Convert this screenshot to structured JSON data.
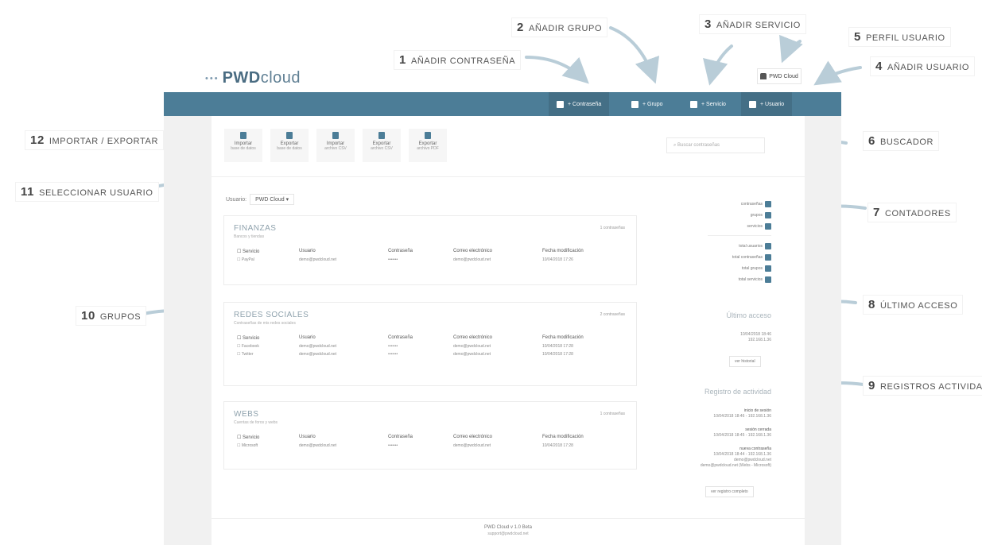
{
  "callouts": [
    {
      "num": "1",
      "label": "AÑADIR CONTRASEÑA"
    },
    {
      "num": "2",
      "label": "AÑADIR GRUPO"
    },
    {
      "num": "3",
      "label": "AÑADIR SERVICIO"
    },
    {
      "num": "4",
      "label": "AÑADIR USUARIO"
    },
    {
      "num": "5",
      "label": "PERFIL USUARIO"
    },
    {
      "num": "6",
      "label": "BUSCADOR"
    },
    {
      "num": "7",
      "label": "CONTADORES"
    },
    {
      "num": "8",
      "label": "ÚLTIMO ACCESO"
    },
    {
      "num": "9",
      "label": "REGISTROS ACTIVIDAD"
    },
    {
      "num": "10",
      "label": "GRUPOS"
    },
    {
      "num": "11",
      "label": "SELECCIONAR USUARIO"
    },
    {
      "num": "12",
      "label": "IMPORTAR / EXPORTAR"
    }
  ],
  "app": {
    "logo_dots": "•••",
    "logo_bold": "PWD",
    "logo_light": "cloud",
    "user_name": "PWD Cloud"
  },
  "topbar": {
    "password_btn": "+ Contraseña",
    "group_btn": "+ Grupo",
    "service_btn": "+ Servicio",
    "user_btn": "+ Usuario"
  },
  "import_export": [
    {
      "label": "Importar",
      "sub": "base de datos"
    },
    {
      "label": "Exportar",
      "sub": "base de datos"
    },
    {
      "label": "Importar",
      "sub": "archivo CSV"
    },
    {
      "label": "Exportar",
      "sub": "archivo CSV"
    },
    {
      "label": "Exportar",
      "sub": "archivo PDF"
    }
  ],
  "search": {
    "placeholder": "Buscar contraseñas"
  },
  "user_select": {
    "label": "Usuario:",
    "value": "PWD Cloud ▾"
  },
  "table_headers": [
    "☐ Servicio",
    "Usuario",
    "Contraseña",
    "Correo electrónico",
    "Fecha modificación"
  ],
  "groups": [
    {
      "name": "FINANZAS",
      "desc": "Bancos y tiendas",
      "count": "1 contraseñas",
      "rows": [
        [
          "☐ PayPal",
          "demo@pwdcloud.net",
          "•••••••",
          "demo@pwdcloud.net",
          "10/04/2018 17:26"
        ]
      ]
    },
    {
      "name": "REDES SOCIALES",
      "desc": "Contraseñas de mis redes sociales",
      "count": "2 contraseñas",
      "rows": [
        [
          "☐ Facebook",
          "demo@pwdcloud.net",
          "•••••••",
          "demo@pwdcloud.net",
          "10/04/2018 17:28"
        ],
        [
          "☐ Twitter",
          "demo@pwdcloud.net",
          "•••••••",
          "demo@pwdcloud.net",
          "10/04/2018 17:28"
        ]
      ]
    },
    {
      "name": "WEBS",
      "desc": "Cuentas de foros y webs",
      "count": "1 contraseñas",
      "rows": [
        [
          "☐ Microsoft",
          "demo@pwdcloud.net",
          "•••••••",
          "demo@pwdcloud.net",
          "10/04/2018 17:28"
        ]
      ]
    }
  ],
  "counters": {
    "top": [
      "contraseñas",
      "grupos",
      "servicios"
    ],
    "bottom": [
      "total usuarios",
      "total contraseñas",
      "total grupos",
      "total servicios"
    ]
  },
  "last_access": {
    "title": "Último acceso",
    "line1": "10/04/2018 18:46",
    "line2": "192.168.1.36",
    "button": "ver historial"
  },
  "activity": {
    "title": "Registro de actividad",
    "entries": [
      {
        "title": "inicio de sesión",
        "detail": "10/04/2018 18:46 - 192.168.1.36"
      },
      {
        "title": "sesión cerrada",
        "detail": "10/04/2018 18:45 - 192.168.1.36"
      },
      {
        "title": "nueva contraseña",
        "detail": "10/04/2018 18:44 - 192.168.1.36"
      }
    ],
    "extra1": "demo@pwdcloud.net",
    "extra2": "demo@pwdcloud.net (Webs - Microsoft)",
    "button": "ver registro completo"
  },
  "footer": {
    "line1": "PWD Cloud v 1.0 Beta",
    "line2": "support@pwdcloud.net"
  }
}
